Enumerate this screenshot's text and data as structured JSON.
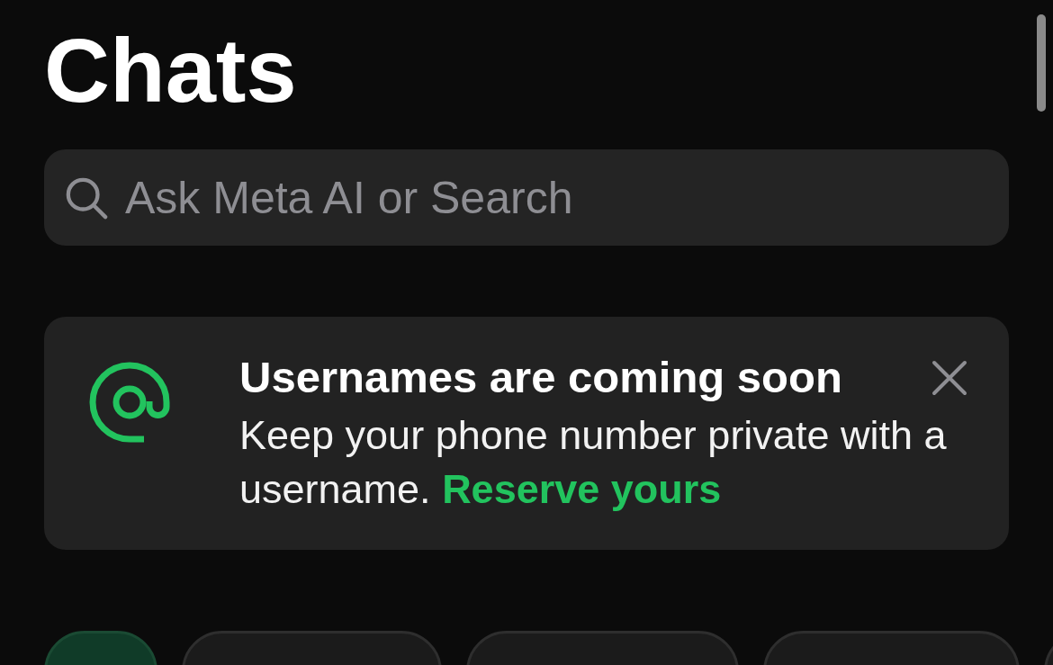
{
  "header": {
    "title": "Chats"
  },
  "search": {
    "placeholder": "Ask Meta AI or Search"
  },
  "banner": {
    "title": "Usernames are coming soon",
    "message": "Keep your phone number private with a username.",
    "link": "Reserve yours"
  },
  "filter_chips": [
    {
      "selected": true
    },
    {
      "selected": false
    },
    {
      "selected": false
    },
    {
      "selected": false
    },
    {
      "selected": false
    }
  ]
}
